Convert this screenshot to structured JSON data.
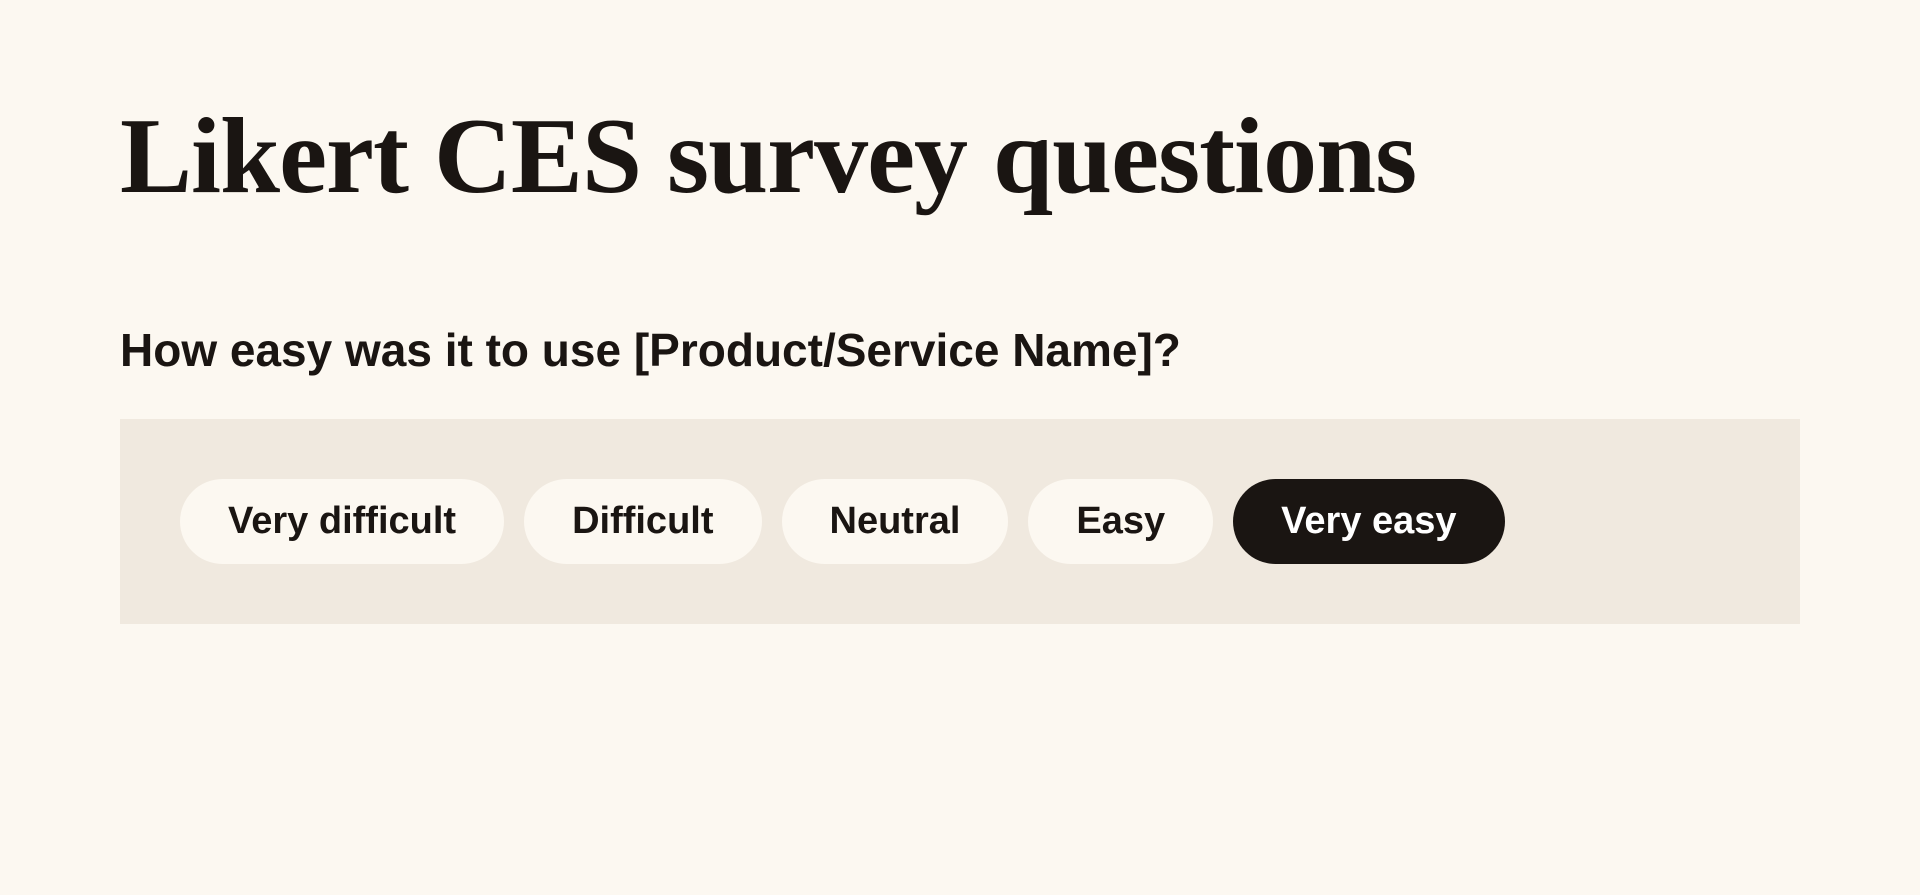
{
  "title": "Likert CES survey questions",
  "question": "How easy was it to use [Product/Service Name]?",
  "options": [
    {
      "label": "Very difficult",
      "selected": false
    },
    {
      "label": "Difficult",
      "selected": false
    },
    {
      "label": "Neutral",
      "selected": false
    },
    {
      "label": "Easy",
      "selected": false
    },
    {
      "label": "Very easy",
      "selected": true
    }
  ]
}
